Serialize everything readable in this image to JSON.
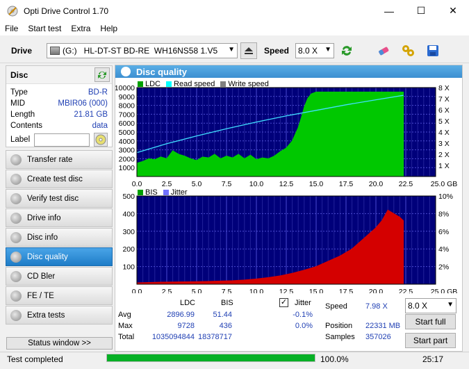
{
  "window": {
    "title": "Opti Drive Control 1.70",
    "minimize": "—",
    "maximize": "☐",
    "close": "✕"
  },
  "menu": [
    "File",
    "Start test",
    "Extra",
    "Help"
  ],
  "toolbar": {
    "drive_label": "Drive",
    "drive_value": "(G:)   HL-DT-ST BD-RE  WH16NS58 1.V5",
    "speed_label": "Speed",
    "speed_value": "8.0 X"
  },
  "disc": {
    "header": "Disc",
    "rows": [
      {
        "label": "Type",
        "value": "BD-R"
      },
      {
        "label": "MID",
        "value": "MBIR06 (000)"
      },
      {
        "label": "Length",
        "value": "21.81 GB"
      },
      {
        "label": "Contents",
        "value": "data"
      }
    ],
    "label_field": "Label",
    "label_value": ""
  },
  "nav": [
    {
      "label": "Transfer rate",
      "active": false
    },
    {
      "label": "Create test disc",
      "active": false
    },
    {
      "label": "Verify test disc",
      "active": false
    },
    {
      "label": "Drive info",
      "active": false
    },
    {
      "label": "Disc info",
      "active": false
    },
    {
      "label": "Disc quality",
      "active": true
    },
    {
      "label": "CD Bler",
      "active": false
    },
    {
      "label": "FE / TE",
      "active": false
    },
    {
      "label": "Extra tests",
      "active": false
    }
  ],
  "status_window_button": "Status window >>",
  "main": {
    "title": "Disc quality",
    "legend_top": [
      {
        "name": "LDC",
        "color": "#00a000"
      },
      {
        "name": "Read speed",
        "color": "#00ffff"
      },
      {
        "name": "Write speed",
        "color": "#808080"
      }
    ],
    "legend_bottom": [
      {
        "name": "BIS",
        "color": "#00a000"
      },
      {
        "name": "Jitter",
        "color": "#7070ff"
      }
    ]
  },
  "chart_data": [
    {
      "type": "area",
      "series": [
        {
          "name": "LDC",
          "color": "#00c800",
          "x": [
            0,
            0.5,
            1,
            1.5,
            2,
            2.5,
            3,
            3.5,
            4,
            4.5,
            5,
            5.5,
            6,
            6.5,
            7,
            7.5,
            8,
            8.5,
            9,
            9.5,
            10,
            10.5,
            11,
            11.5,
            12,
            12.5,
            13,
            13.5,
            13.8,
            14,
            14.3,
            14.6,
            15,
            15.5,
            16,
            17,
            18,
            19,
            20,
            21,
            22,
            22.3
          ],
          "y": [
            1500,
            1700,
            2000,
            1900,
            2200,
            2000,
            2900,
            2500,
            2300,
            2000,
            1800,
            2200,
            2100,
            2500,
            2000,
            2300,
            2100,
            2500,
            2000,
            2400,
            1900,
            2100,
            2000,
            2300,
            2800,
            3200,
            4000,
            5500,
            6800,
            7800,
            8800,
            9300,
            9500,
            9500,
            9500,
            9500,
            9500,
            9500,
            9500,
            9500,
            9500,
            9500
          ]
        },
        {
          "name": "Read speed",
          "color": "#40e0ff",
          "x": [
            0,
            2.5,
            5,
            7.5,
            10,
            12.5,
            15,
            17.5,
            20,
            22.3
          ],
          "y": [
            2.15,
            2.95,
            3.65,
            4.3,
            4.9,
            5.45,
            5.95,
            6.45,
            6.9,
            7.3
          ]
        }
      ],
      "xlim": [
        0,
        25
      ],
      "ylim": [
        0,
        10000
      ],
      "y2lim": [
        0,
        8
      ],
      "xticks": [
        "0.0",
        "2.5",
        "5.0",
        "7.5",
        "10.0",
        "12.5",
        "15.0",
        "17.5",
        "20.0",
        "22.5",
        "25.0 GB"
      ],
      "yticks": [
        "1000",
        "2000",
        "3000",
        "4000",
        "5000",
        "6000",
        "7000",
        "8000",
        "9000",
        "10000"
      ],
      "y2ticks": [
        "1 X",
        "2 X",
        "3 X",
        "4 X",
        "5 X",
        "6 X",
        "7 X",
        "8 X"
      ]
    },
    {
      "type": "area",
      "series": [
        {
          "name": "BIS",
          "color": "#d40000",
          "x": [
            0,
            1,
            2,
            3,
            4,
            5,
            6,
            7,
            8,
            9,
            10,
            11,
            12,
            13,
            14,
            15,
            16,
            17,
            18,
            19,
            20,
            20.5,
            21,
            21.5,
            22,
            22.3
          ],
          "y": [
            8,
            10,
            12,
            13,
            14,
            15,
            16,
            18,
            20,
            24,
            30,
            38,
            48,
            62,
            80,
            100,
            130,
            160,
            200,
            260,
            320,
            360,
            420,
            400,
            380,
            360
          ]
        }
      ],
      "xlim": [
        0,
        25
      ],
      "ylim": [
        0,
        500
      ],
      "y2lim": [
        0,
        10
      ],
      "xticks": [
        "0.0",
        "2.5",
        "5.0",
        "7.5",
        "10.0",
        "12.5",
        "15.0",
        "17.5",
        "20.0",
        "22.5",
        "25.0 GB"
      ],
      "yticks": [
        "100",
        "200",
        "300",
        "400",
        "500"
      ],
      "y2ticks": [
        "2%",
        "4%",
        "6%",
        "8%",
        "10%"
      ]
    }
  ],
  "stats": {
    "col_ldc": "LDC",
    "col_bis": "BIS",
    "jitter_label": "Jitter",
    "rows": [
      {
        "label": "Avg",
        "ldc": "2896.99",
        "bis": "51.44",
        "jitter": "-0.1%"
      },
      {
        "label": "Max",
        "ldc": "9728",
        "bis": "436",
        "jitter": "0.0%"
      },
      {
        "label": "Total",
        "ldc": "1035094844",
        "bis": "18378717",
        "jitter": ""
      }
    ],
    "speed_label": "Speed",
    "speed_value": "7.98 X",
    "position_label": "Position",
    "position_value": "22331 MB",
    "samples_label": "Samples",
    "samples_value": "357026",
    "speed_select": "8.0 X",
    "start_full": "Start full",
    "start_part": "Start part"
  },
  "statusbar": {
    "status": "Test completed",
    "progress": "100.0%",
    "progress_value": 1.0,
    "time": "25:17"
  }
}
